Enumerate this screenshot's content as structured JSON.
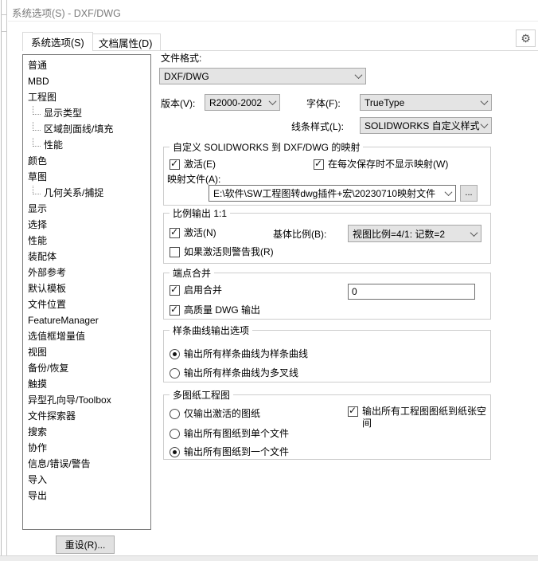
{
  "window": {
    "title": "系统选项(S) - DXF/DWG"
  },
  "tabs": {
    "system": "系统选项(S)",
    "document": "文档属性(D)"
  },
  "sidebar": {
    "items": [
      {
        "label": "普通",
        "child": false
      },
      {
        "label": "MBD",
        "child": false
      },
      {
        "label": "工程图",
        "child": false
      },
      {
        "label": "显示类型",
        "child": true
      },
      {
        "label": "区域剖面线/填充",
        "child": true
      },
      {
        "label": "性能",
        "child": true
      },
      {
        "label": "颜色",
        "child": false
      },
      {
        "label": "草图",
        "child": false
      },
      {
        "label": "几何关系/捕捉",
        "child": true
      },
      {
        "label": "显示",
        "child": false
      },
      {
        "label": "选择",
        "child": false
      },
      {
        "label": "性能",
        "child": false
      },
      {
        "label": "装配体",
        "child": false
      },
      {
        "label": "外部参考",
        "child": false
      },
      {
        "label": "默认模板",
        "child": false
      },
      {
        "label": "文件位置",
        "child": false
      },
      {
        "label": "FeatureManager",
        "child": false
      },
      {
        "label": "选值框增量值",
        "child": false
      },
      {
        "label": "视图",
        "child": false
      },
      {
        "label": "备份/恢复",
        "child": false
      },
      {
        "label": "触摸",
        "child": false
      },
      {
        "label": "异型孔向导/Toolbox",
        "child": false
      },
      {
        "label": "文件探索器",
        "child": false
      },
      {
        "label": "搜索",
        "child": false
      },
      {
        "label": "协作",
        "child": false
      },
      {
        "label": "信息/错误/警告",
        "child": false
      },
      {
        "label": "导入",
        "child": false
      },
      {
        "label": "导出",
        "child": false
      }
    ]
  },
  "reset_button": "重设(R)...",
  "gear_icon": "⚙",
  "panel": {
    "file_format": {
      "label": "文件格式:",
      "value": "DXF/DWG"
    },
    "version": {
      "label": "版本(V):",
      "value": "R2000-2002"
    },
    "font": {
      "label": "字体(F):",
      "value": "TrueType"
    },
    "line_style": {
      "label": "线条样式(L):",
      "value": "SOLIDWORKS 自定义样式"
    },
    "mapping": {
      "title": "自定义 SOLIDWORKS 到 DXF/DWG 的映射",
      "activate": {
        "label": "激活(E)",
        "checked": true
      },
      "dont_show": {
        "label": "在每次保存时不显示映射(W)",
        "checked": true
      },
      "map_file_label": "映射文件(A):",
      "map_file_value": "E:\\软件\\SW工程图转dwg插件+宏\\20230710映射文件",
      "browse_label": "..."
    },
    "scale": {
      "title": "比例输出 1:1",
      "activate": {
        "label": "激活(N)",
        "checked": true
      },
      "base_scale_label": "基体比例(B):",
      "base_scale_value": "视图比例=4/1: 记数=2",
      "warn": {
        "label": "如果激活则警告我(R)",
        "checked": false
      }
    },
    "endpoint": {
      "title": "端点合并",
      "enable": {
        "label": "启用合并",
        "checked": true
      },
      "value": "0",
      "high_quality": {
        "label": "高质量 DWG 输出",
        "checked": true
      }
    },
    "spline": {
      "title": "样条曲线输出选项",
      "opt_spline": {
        "label": "输出所有样条曲线为样条曲线",
        "selected": true
      },
      "opt_poly": {
        "label": "输出所有样条曲线为多叉线",
        "selected": false
      }
    },
    "multisheet": {
      "title": "多图纸工程图",
      "opt_active": {
        "label": "仅输出激活的图纸",
        "selected": false
      },
      "opt_separate": {
        "label": "输出所有图纸到单个文件",
        "selected": false
      },
      "opt_one": {
        "label": "输出所有图纸到一个文件",
        "selected": true
      },
      "paper_space": {
        "label": "输出所有工程图图纸到纸张空间",
        "checked": true
      }
    }
  },
  "colors": {
    "accent_border": "#a6a6a6",
    "group_border": "#cdcdcd",
    "title_text": "#7c7c7c"
  }
}
